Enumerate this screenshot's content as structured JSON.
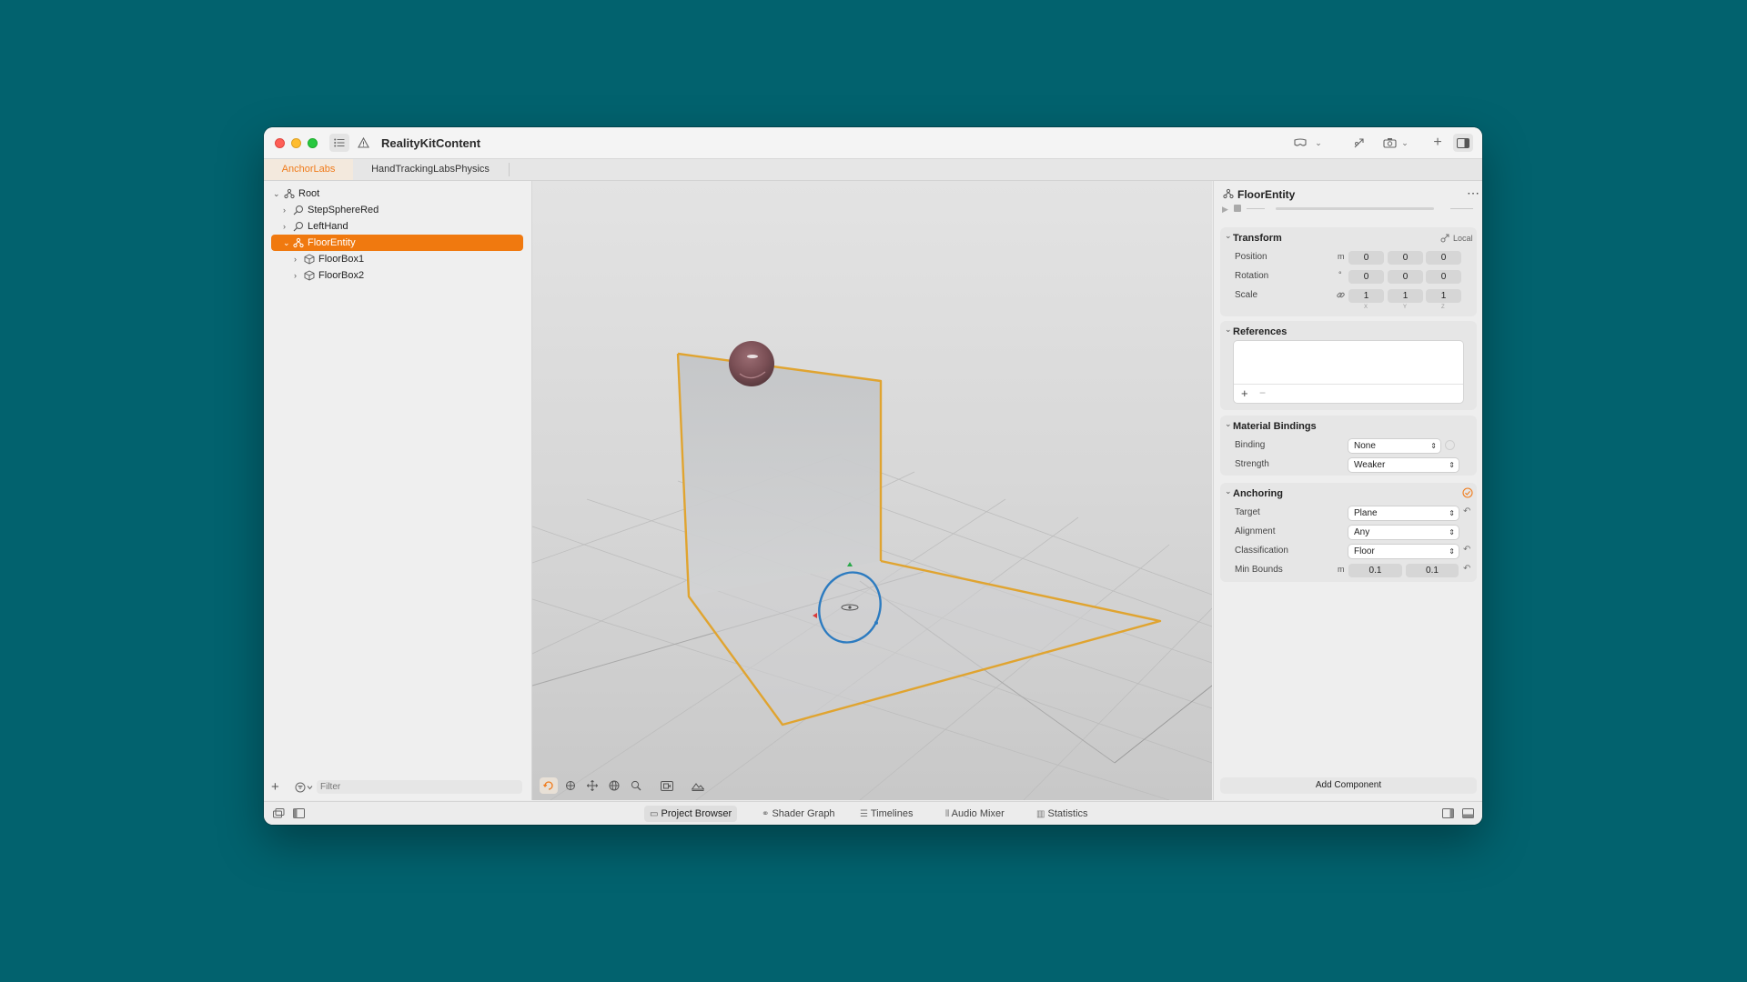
{
  "window": {
    "title": "RealityKitContent"
  },
  "tabs": [
    {
      "label": "AnchorLabs",
      "active": true
    },
    {
      "label": "HandTrackingLabsPhysics",
      "active": false
    }
  ],
  "tree": [
    {
      "label": "Root",
      "icon": "entity-icon",
      "selected": false
    },
    {
      "label": "StepSphereRed",
      "icon": "search-icon",
      "selected": false
    },
    {
      "label": "LeftHand",
      "icon": "search-icon",
      "selected": false
    },
    {
      "label": "FloorEntity",
      "icon": "entity-icon",
      "selected": true
    },
    {
      "label": "FloorBox1",
      "icon": "cube-icon",
      "selected": false
    },
    {
      "label": "FloorBox2",
      "icon": "cube-icon",
      "selected": false
    }
  ],
  "filter": {
    "placeholder": "Filter"
  },
  "inspector": {
    "entity_name": "FloorEntity",
    "transform": {
      "title": "Transform",
      "space": "Local",
      "position_label": "Position",
      "position_unit": "m",
      "position": [
        "0",
        "0",
        "0"
      ],
      "rotation_label": "Rotation",
      "rotation_unit": "°",
      "rotation": [
        "0",
        "0",
        "0"
      ],
      "scale_label": "Scale",
      "scale": [
        "1",
        "1",
        "1"
      ],
      "axis_labels": [
        "X",
        "Y",
        "Z"
      ]
    },
    "references": {
      "title": "References"
    },
    "material_bindings": {
      "title": "Material Bindings",
      "binding_label": "Binding",
      "binding_value": "None",
      "strength_label": "Strength",
      "strength_value": "Weaker"
    },
    "anchoring": {
      "title": "Anchoring",
      "target_label": "Target",
      "target_value": "Plane",
      "alignment_label": "Alignment",
      "alignment_value": "Any",
      "classification_label": "Classification",
      "classification_value": "Floor",
      "min_bounds_label": "Min Bounds",
      "min_bounds_unit": "m",
      "min_bounds": [
        "0.1",
        "0.1"
      ]
    },
    "add_component": "Add Component"
  },
  "bottom_tabs": [
    {
      "label": "Project Browser",
      "active": true
    },
    {
      "label": "Shader Graph",
      "active": false
    },
    {
      "label": "Timelines",
      "active": false
    },
    {
      "label": "Audio Mixer",
      "active": false
    },
    {
      "label": "Statistics",
      "active": false
    }
  ],
  "colors": {
    "accent": "#f0790f",
    "plane_outline": "#e0a430",
    "gizmo_blue": "#2c7bc0",
    "background": "#02626e"
  }
}
